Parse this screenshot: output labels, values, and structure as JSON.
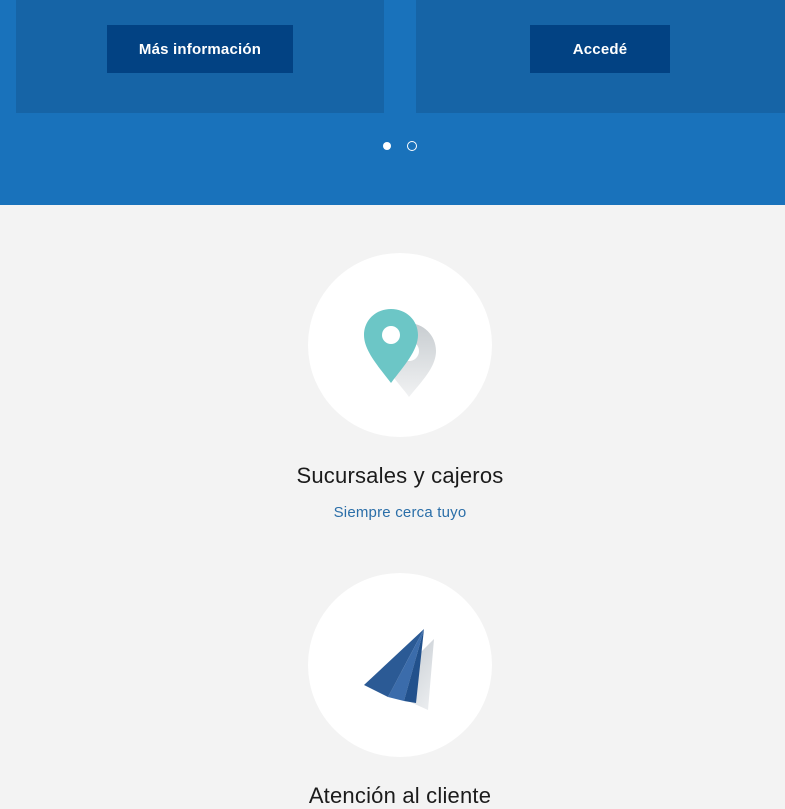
{
  "hero": {
    "cards": [
      {
        "button_label": "Más información"
      },
      {
        "button_label": "Accedé"
      }
    ],
    "carousel": {
      "active_index": 0,
      "count": 2
    }
  },
  "features": [
    {
      "icon": "map-pin-icon",
      "title": "Sucursales y cajeros",
      "link": "Siempre cerca tuyo"
    },
    {
      "icon": "paper-plane-icon",
      "title": "Atención al cliente"
    }
  ],
  "colors": {
    "hero_bg": "#1972bb",
    "card_bg": "#1664a6",
    "button_bg": "#024283",
    "page_bg": "#f3f3f3",
    "link": "#2a6ea8",
    "pin_teal": "#6cc6c6"
  }
}
